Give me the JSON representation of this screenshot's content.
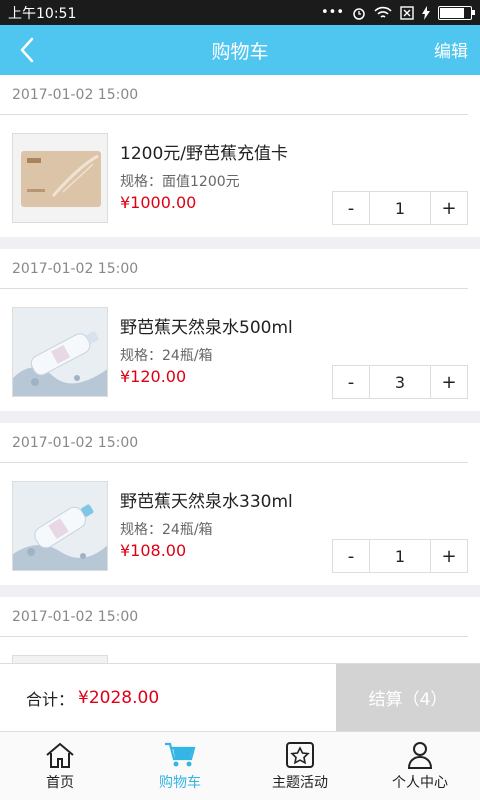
{
  "status": {
    "time": "上午10:51"
  },
  "header": {
    "title": "购物车",
    "edit_label": "编辑"
  },
  "groups": [
    {
      "date": "2017-01-02 15:00",
      "name": "1200元/野芭蕉充值卡",
      "spec": "规格：面值1200元",
      "price": "¥1000.00",
      "qty": "1",
      "image": "gift-card"
    },
    {
      "date": "2017-01-02 15:00",
      "name": "野芭蕉天然泉水500ml",
      "spec": "规格：24瓶/箱",
      "price": "¥120.00",
      "qty": "3",
      "image": "water-bottle"
    },
    {
      "date": "2017-01-02 15:00",
      "name": "野芭蕉天然泉水330ml",
      "spec": "规格：24瓶/箱",
      "price": "¥108.00",
      "qty": "1",
      "image": "water-bottle"
    },
    {
      "date": "2017-01-02 15:00"
    }
  ],
  "controls": {
    "minus": "-",
    "plus": "+"
  },
  "checkout": {
    "total_label": "合计：",
    "total_amount": "¥2028.00",
    "submit_label": "结算（4）"
  },
  "tabs": [
    {
      "label": "首页",
      "icon": "home-icon"
    },
    {
      "label": "购物车",
      "icon": "cart-icon",
      "active": true
    },
    {
      "label": "主题活动",
      "icon": "star-box-icon"
    },
    {
      "label": "个人中心",
      "icon": "person-icon"
    }
  ],
  "colors": {
    "header": "#4fc6ef",
    "price": "#e00015",
    "active_tab": "#35b5e5"
  }
}
